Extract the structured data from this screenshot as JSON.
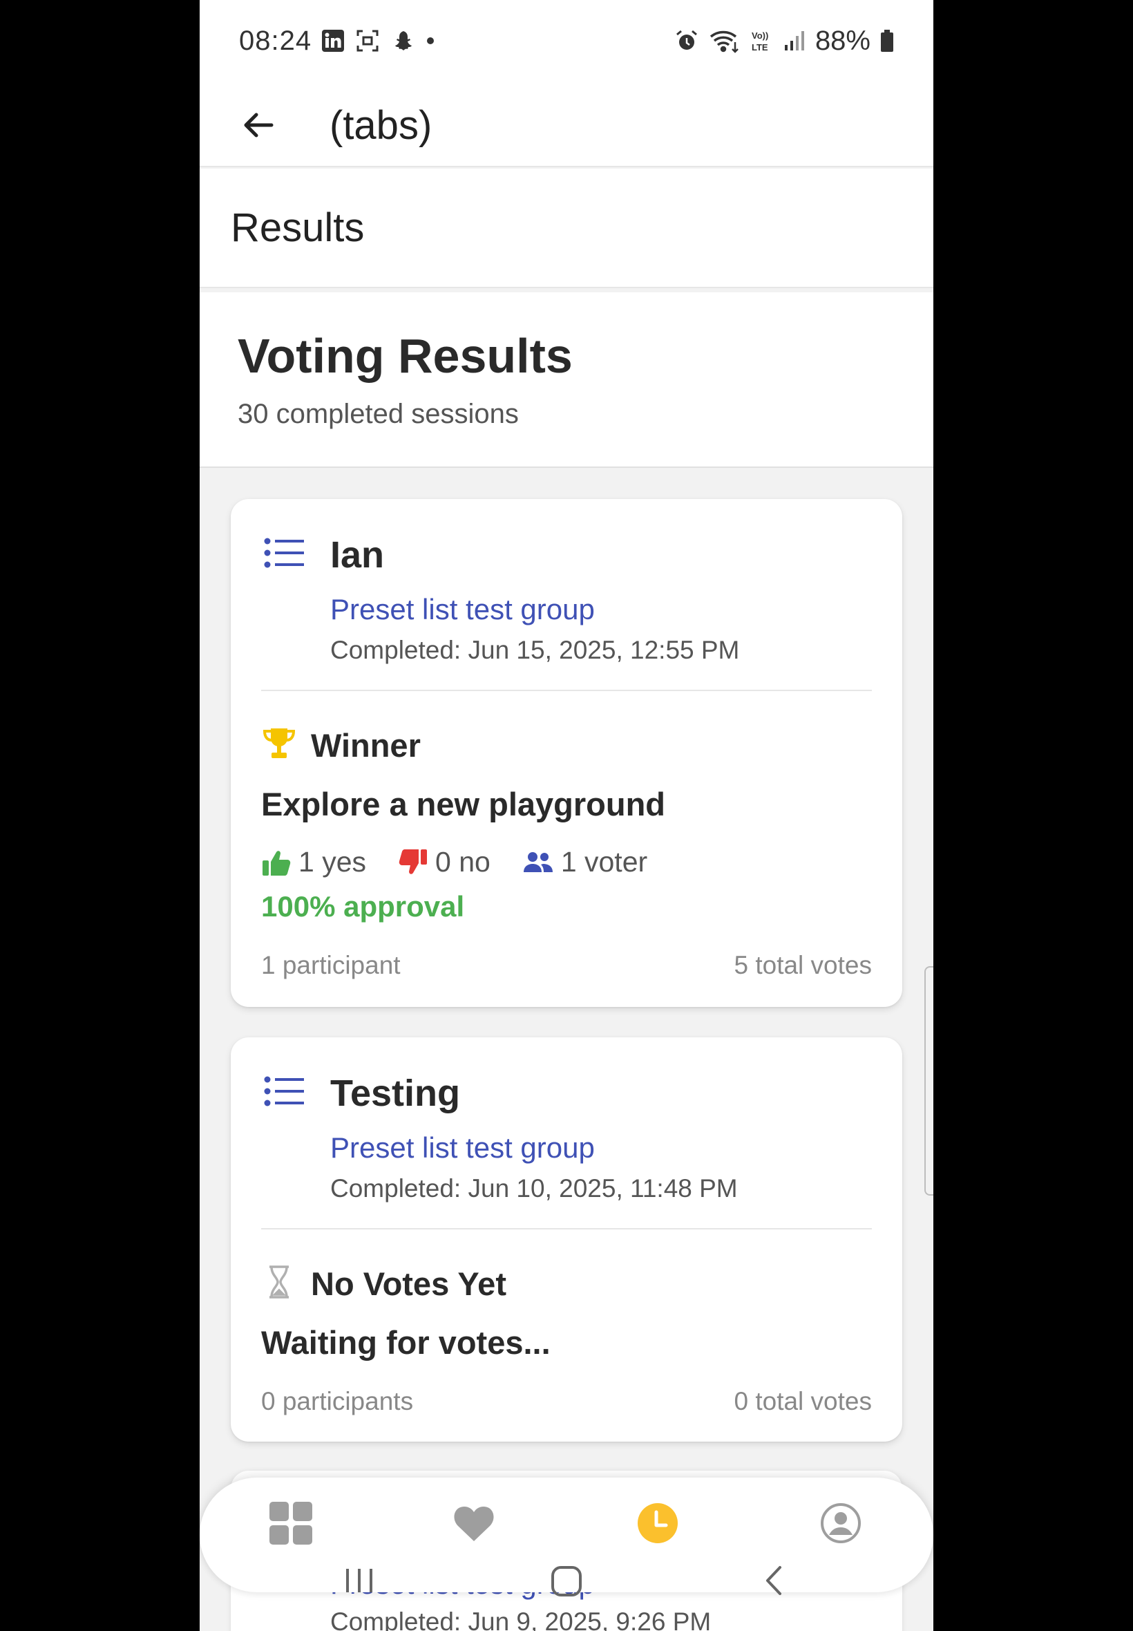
{
  "status_bar": {
    "time": "08:24",
    "battery": "88%",
    "icons_left": [
      "linkedin-icon",
      "screenshot-icon",
      "snapchat-icon",
      "dot-icon"
    ],
    "icons_right": [
      "alarm-icon",
      "wifi-icon",
      "volte-icon",
      "signal-icon",
      "battery-icon"
    ]
  },
  "header": {
    "title": "(tabs)"
  },
  "subheader": {
    "title": "Results"
  },
  "intro": {
    "title": "Voting Results",
    "subtitle": "30 completed sessions"
  },
  "cards": [
    {
      "name": "Ian",
      "group": "Preset list test group",
      "completed": "Completed: Jun 15, 2025, 12:55 PM",
      "status_label": "Winner",
      "result_title": "Explore a new playground",
      "yes": "1 yes",
      "no": "0 no",
      "voters": "1 voter",
      "approval": "100% approval",
      "participants": "1 participant",
      "total_votes": "5 total votes"
    },
    {
      "name": "Testing",
      "group": "Preset list test group",
      "completed": "Completed: Jun 10, 2025, 11:48 PM",
      "status_label": "No Votes Yet",
      "result_title": "Waiting for votes...",
      "participants": "0 participants",
      "total_votes": "0 total votes"
    },
    {
      "group": "Preset list test group",
      "completed": "Completed: Jun 9, 2025, 9:26 PM"
    }
  ],
  "tabs": [
    {
      "name": "grid-icon",
      "active": false
    },
    {
      "name": "heart-icon",
      "active": false
    },
    {
      "name": "clock-icon",
      "active": true
    },
    {
      "name": "account-icon",
      "active": false
    }
  ],
  "colors": {
    "accent": "#3f51b5",
    "approval": "#4caf50",
    "yes": "#4caf50",
    "no": "#e53935",
    "trophy": "#f5c400",
    "active_tab": "#fbc02d",
    "inactive_tab": "#9e9e9e"
  }
}
